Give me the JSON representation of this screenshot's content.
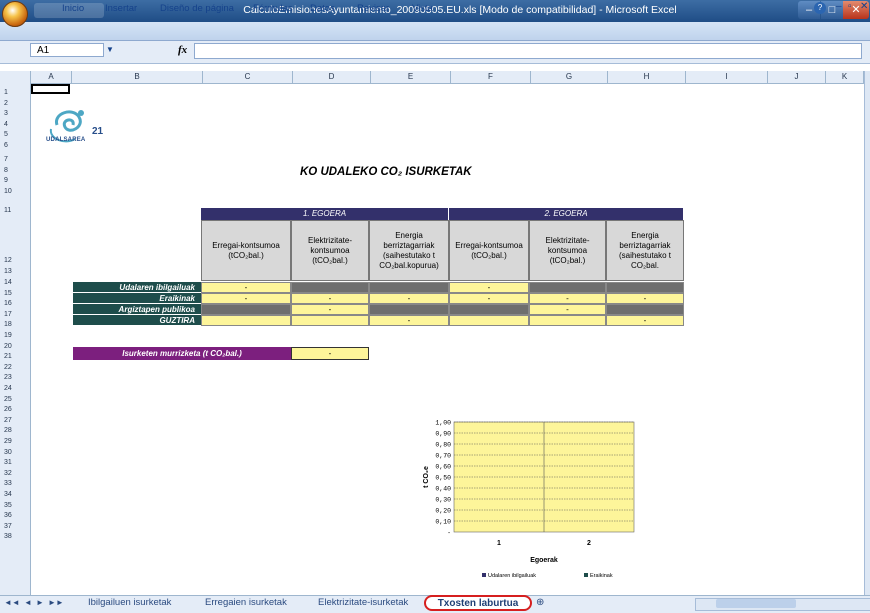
{
  "window": {
    "title": "CalculoEmisionesAyuntamiento_20090505.EU.xls  [Modo de compatibilidad] - Microsoft Excel",
    "controls": [
      "–",
      "□",
      "✕"
    ]
  },
  "ribbon": {
    "tabs": [
      "Inicio",
      "Insertar",
      "Diseño de página",
      "Fórmulas",
      "Datos",
      "Revisar",
      "Vista"
    ]
  },
  "formula_bar": {
    "name_box": "A1",
    "fx": "fx",
    "value": ""
  },
  "columns": [
    "A",
    "B",
    "C",
    "D",
    "E",
    "F",
    "G",
    "H",
    "I",
    "J",
    "K"
  ],
  "rows": [
    "1",
    "2",
    "3",
    "4",
    "5",
    "6",
    "7",
    "8",
    "9",
    "10",
    "11",
    "12",
    "13",
    "14",
    "15",
    "16",
    "17",
    "18",
    "19",
    "20",
    "21",
    "22",
    "23",
    "24",
    "25",
    "26",
    "27",
    "28",
    "29",
    "30",
    "31",
    "32",
    "33",
    "34",
    "35",
    "36",
    "37",
    "38"
  ],
  "logo": {
    "text": "UDALSAREA",
    "number": "21"
  },
  "sheet_title": "KO UDALEKO CO₂ ISURKETAK",
  "table": {
    "groups": [
      "1. EGOERA",
      "2. EGOERA"
    ],
    "col_headers": [
      "Erregai-kontsumoa (tCO₂bal.)",
      "Elektrizitate-kontsumoa (tCO₂bal.)",
      "Energia berriztagarriak (saihestutako t CO₂bal.kopurua)",
      "Erregai-kontsumoa (tCO₂bal.)",
      "Elektrizitate-kontsumoa (tCO₂bal.)",
      "Energia berriztagarriak (saihestutako t CO₂bal."
    ],
    "rows": [
      {
        "label": "Udalaren ibilgailuak",
        "cells": [
          "-",
          "",
          "",
          "-",
          "",
          ""
        ]
      },
      {
        "label": "Eraikinak",
        "cells": [
          "-",
          "-",
          "-",
          "-",
          "-",
          "-"
        ]
      },
      {
        "label": "Argiztapen publikoa",
        "cells": [
          "",
          "-",
          "",
          "",
          "-",
          ""
        ]
      },
      {
        "label": "GUZTIRA",
        "cells": [
          "",
          "",
          "-",
          "",
          "",
          "-"
        ]
      }
    ]
  },
  "reduction": {
    "label": "Isurketen murrizketa (t CO₂bal.)",
    "value": "-"
  },
  "chart_data": {
    "type": "bar",
    "categories": [
      "1",
      "2"
    ],
    "series": [
      {
        "name": "Udalaren ibilgailuak",
        "values": [
          0,
          0
        ]
      },
      {
        "name": "Eraikinak",
        "values": [
          0,
          0
        ]
      }
    ],
    "ylabel": "t CO₂e",
    "xlabel": "Egoerak",
    "ylim": [
      0,
      1
    ],
    "yticks": [
      "1,00",
      "0,90",
      "0,80",
      "0,70",
      "0,60",
      "0,50",
      "0,40",
      "0,30",
      "0,20",
      "0,10",
      "-"
    ],
    "legend": "bottom",
    "colors": {
      "plot_bg": "#fdf59a",
      "series1": "#33306b",
      "series2": "#1e4d4b"
    }
  },
  "sheet_tabs": [
    "Ibilgailuen isurketak",
    "Erregaien isurketak",
    "Elektrizitate-isurketak",
    "Txosten laburtua"
  ],
  "nav_buttons": [
    "◄◄",
    "◄",
    "►",
    "►►"
  ]
}
